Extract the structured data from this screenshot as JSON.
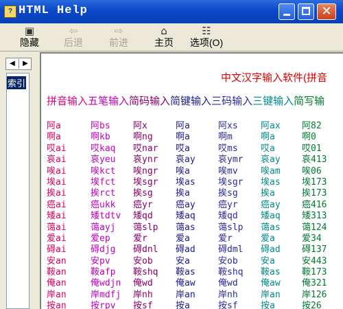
{
  "window": {
    "title": "HTML Help",
    "app_icon": "help-book-icon"
  },
  "toolbar": [
    {
      "name": "hide",
      "label": "隐藏",
      "icon": "hide-pane-icon",
      "glyph": "▣",
      "enabled": true
    },
    {
      "name": "back",
      "label": "后退",
      "icon": "back-arrow-icon",
      "glyph": "⇦",
      "enabled": false
    },
    {
      "name": "forward",
      "label": "前进",
      "icon": "forward-arrow-icon",
      "glyph": "⇨",
      "enabled": false
    },
    {
      "name": "home",
      "label": "主页",
      "icon": "home-icon",
      "glyph": "⌂",
      "enabled": true
    },
    {
      "name": "options",
      "label": "选项(O)",
      "icon": "options-icon",
      "glyph": "☷",
      "enabled": true
    }
  ],
  "nav": {
    "tab": "索引"
  },
  "content": {
    "heading": "中文汉字输入软件(拼音",
    "methods": [
      {
        "text": "拼音输入",
        "color": "#e0007a"
      },
      {
        "text": "五笔输入",
        "color": "#c000c0"
      },
      {
        "text": "简码输入",
        "color": "#8a006a"
      },
      {
        "text": "简键输入",
        "color": "#1a1a90"
      },
      {
        "text": "三码输入",
        "color": "#2a2aa0"
      },
      {
        "text": "三键输入",
        "color": "#008a8a"
      },
      {
        "text": "简写输",
        "color": "#007a30"
      }
    ],
    "columns": [
      {
        "color": "#e00060",
        "cells": [
          "阿a",
          "啊a",
          "哎ai",
          "哀ai",
          "唉ai",
          "埃ai",
          "挨ai",
          "癌ai",
          "矮ai",
          "蔼ai",
          "爱ai",
          "碍ai",
          "安an",
          "鞍an",
          "俺an",
          "岸an",
          "按an"
        ]
      },
      {
        "color": "#c000c0",
        "cells": [
          "阿bs",
          "啊kb",
          "哎kaq",
          "哀yeu",
          "唉kct",
          "埃fct",
          "挨rct",
          "癌ukk",
          "矮tdtv",
          "蔼ayj",
          "爱ep",
          "碍djg",
          "安pv",
          "鞍afp",
          "俺wdjn",
          "岸mdfj",
          "按rpv"
        ]
      },
      {
        "color": "#8a006a",
        "cells": [
          "阿x",
          "啊ng",
          "哎nar",
          "哀ynr",
          "唉ngr",
          "埃sgr",
          "挨sg",
          "癌yr",
          "矮qd",
          "蔼slp",
          "爱r",
          "碍dnl",
          "安ob",
          "鞍shq",
          "俺wd",
          "岸nh",
          "按sf"
        ]
      },
      {
        "color": "#1a1a90",
        "cells": [
          "阿a",
          "啊a",
          "哎a",
          "哀ay",
          "唉a",
          "埃as",
          "挨a",
          "癌ay",
          "矮aq",
          "蔼as",
          "爱a",
          "碍ad",
          "安a",
          "鞍as",
          "俺aw",
          "岸an",
          "按a"
        ]
      },
      {
        "color": "#2a2aa0",
        "cells": [
          "阿xs",
          "啊m",
          "哎ms",
          "哀ymr",
          "唉mv",
          "埃sgr",
          "挨sg",
          "癌yr",
          "矮qd",
          "蔼slp",
          "爱r",
          "碍dml",
          "安ob",
          "鞍shq",
          "俺wd",
          "岸nh",
          "按sf"
        ]
      },
      {
        "color": "#008a8a",
        "cells": [
          "阿ax",
          "啊a",
          "哎a",
          "哀ay",
          "唉am",
          "埃as",
          "挨a",
          "癌ay",
          "矮aq",
          "蔼as",
          "爱a",
          "碍ad",
          "安a",
          "鞍as",
          "俺aw",
          "岸an",
          "按a"
        ]
      },
      {
        "color": "#007a30",
        "cells": [
          "阿82",
          "啊0",
          "哎01",
          "哀413",
          "唉06",
          "埃173",
          "挨173",
          "癌416",
          "矮313",
          "蔼124",
          "爱34",
          "碍137",
          "安443",
          "鞍173",
          "俺321",
          "岸126",
          "按26"
        ]
      }
    ]
  }
}
